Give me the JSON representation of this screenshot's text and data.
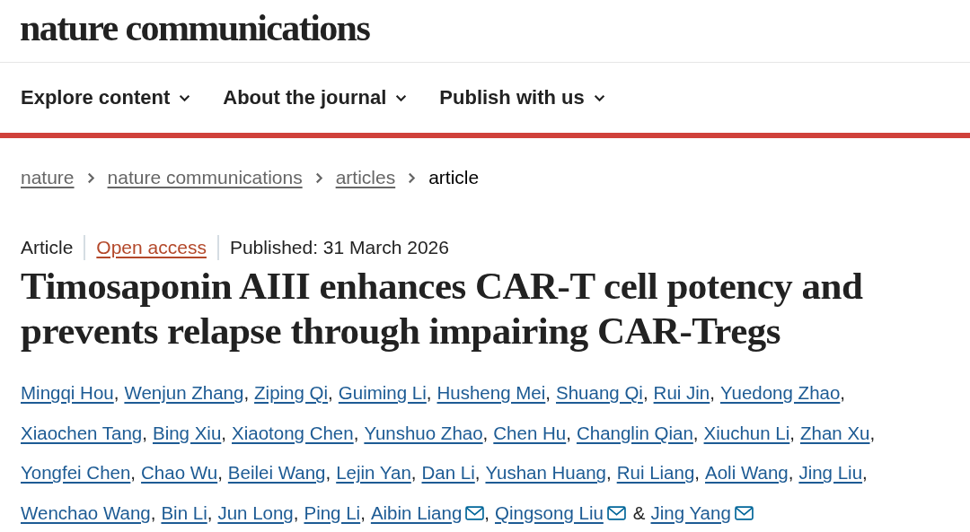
{
  "site": {
    "logo": "nature communications"
  },
  "nav": [
    {
      "label": "Explore content"
    },
    {
      "label": "About the journal"
    },
    {
      "label": "Publish with us"
    }
  ],
  "breadcrumbs": [
    {
      "label": "nature",
      "kind": "link"
    },
    {
      "label": "nature communications",
      "kind": "link"
    },
    {
      "label": "articles",
      "kind": "link"
    },
    {
      "label": "article",
      "kind": "current"
    }
  ],
  "meta": [
    {
      "label": "Article",
      "kind": "text"
    },
    {
      "label": "Open access",
      "kind": "link"
    },
    {
      "label": "Published: 31 March 2026",
      "kind": "text"
    }
  ],
  "title": "Timosaponin AIII enhances CAR-T cell potency and prevents relapse through impairing CAR-Tregs",
  "author_lines": [
    [
      {
        "name": "Mingqi Hou",
        "email": false,
        "after": ","
      },
      {
        "name": "Wenjun Zhang",
        "email": false,
        "after": ","
      },
      {
        "name": "Ziping Qi",
        "email": false,
        "after": ","
      },
      {
        "name": "Guiming Li",
        "email": false,
        "after": ","
      },
      {
        "name": "Husheng Mei",
        "email": false,
        "after": ","
      },
      {
        "name": "Shuang Qi",
        "email": false,
        "after": ","
      },
      {
        "name": "Rui Jin",
        "email": false,
        "after": ","
      },
      {
        "name": "Yuedong Zhao",
        "email": false,
        "after": ","
      }
    ],
    [
      {
        "name": "Xiaochen Tang",
        "email": false,
        "after": ","
      },
      {
        "name": "Bing Xiu",
        "email": false,
        "after": ","
      },
      {
        "name": "Xiaotong Chen",
        "email": false,
        "after": ","
      },
      {
        "name": "Yunshuo Zhao",
        "email": false,
        "after": ","
      },
      {
        "name": "Chen Hu",
        "email": false,
        "after": ","
      },
      {
        "name": "Changlin Qian",
        "email": false,
        "after": ","
      },
      {
        "name": "Xiuchun Li",
        "email": false,
        "after": ","
      },
      {
        "name": "Zhan Xu",
        "email": false,
        "after": ","
      }
    ],
    [
      {
        "name": "Yongfei Chen",
        "email": false,
        "after": ","
      },
      {
        "name": "Chao Wu",
        "email": false,
        "after": ","
      },
      {
        "name": "Beilei Wang",
        "email": false,
        "after": ","
      },
      {
        "name": "Lejin Yan",
        "email": false,
        "after": ","
      },
      {
        "name": "Dan Li",
        "email": false,
        "after": ","
      },
      {
        "name": "Yushan Huang",
        "email": false,
        "after": ","
      },
      {
        "name": "Rui Liang",
        "email": false,
        "after": ","
      },
      {
        "name": "Aoli Wang",
        "email": false,
        "after": ","
      },
      {
        "name": "Jing Liu",
        "email": false,
        "after": ","
      }
    ],
    [
      {
        "name": "Wenchao Wang",
        "email": false,
        "after": ","
      },
      {
        "name": "Bin Li",
        "email": false,
        "after": ","
      },
      {
        "name": "Jun Long",
        "email": false,
        "after": ","
      },
      {
        "name": "Ping Li",
        "email": false,
        "after": ","
      },
      {
        "name": "Aibin Liang",
        "email": true,
        "after": ","
      },
      {
        "name": "Qingsong Liu",
        "email": true,
        "after": "&"
      },
      {
        "name": "Jing Yang",
        "email": true
      }
    ]
  ]
}
